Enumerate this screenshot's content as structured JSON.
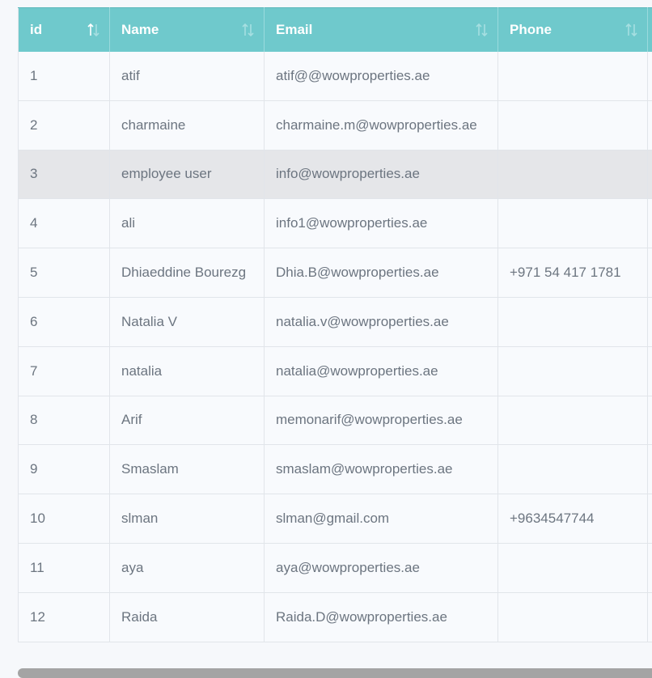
{
  "table": {
    "columns": [
      {
        "label": "id",
        "sort_active": true
      },
      {
        "label": "Name",
        "sort_active": false
      },
      {
        "label": "Email",
        "sort_active": false
      },
      {
        "label": "Phone",
        "sort_active": false
      }
    ],
    "rows": [
      {
        "id": "1",
        "name": "atif",
        "email": "atif@@wowproperties.ae",
        "phone": ""
      },
      {
        "id": "2",
        "name": "charmaine",
        "email": "charmaine.m@wowproperties.ae",
        "phone": ""
      },
      {
        "id": "3",
        "name": "employee user",
        "email": "info@wowproperties.ae",
        "phone": ""
      },
      {
        "id": "4",
        "name": "ali",
        "email": "info1@wowproperties.ae",
        "phone": ""
      },
      {
        "id": "5",
        "name": "Dhiaeddine Bourezg",
        "email": "Dhia.B@wowproperties.ae",
        "phone": "+971 54 417 1781"
      },
      {
        "id": "6",
        "name": "Natalia V",
        "email": "natalia.v@wowproperties.ae",
        "phone": ""
      },
      {
        "id": "7",
        "name": "natalia",
        "email": "natalia@wowproperties.ae",
        "phone": ""
      },
      {
        "id": "8",
        "name": "Arif",
        "email": "memonarif@wowproperties.ae",
        "phone": ""
      },
      {
        "id": "9",
        "name": "Smaslam",
        "email": "smaslam@wowproperties.ae",
        "phone": ""
      },
      {
        "id": "10",
        "name": "slman",
        "email": "slman@gmail.com",
        "phone": "+9634547744"
      },
      {
        "id": "11",
        "name": "aya",
        "email": "aya@wowproperties.ae",
        "phone": ""
      },
      {
        "id": "12",
        "name": "Raida",
        "email": "Raida.D@wowproperties.ae",
        "phone": ""
      }
    ],
    "highlighted_row": 2
  },
  "colors": {
    "header_bg": "#6fc9cc",
    "header_text": "#ffffff",
    "row_highlight": "#e5e6e9",
    "cell_text": "#6c7580",
    "sort_active": "#ffffff",
    "sort_inactive": "#a6dfe1"
  },
  "icons": {
    "sort": "sort-arrows-icon"
  }
}
